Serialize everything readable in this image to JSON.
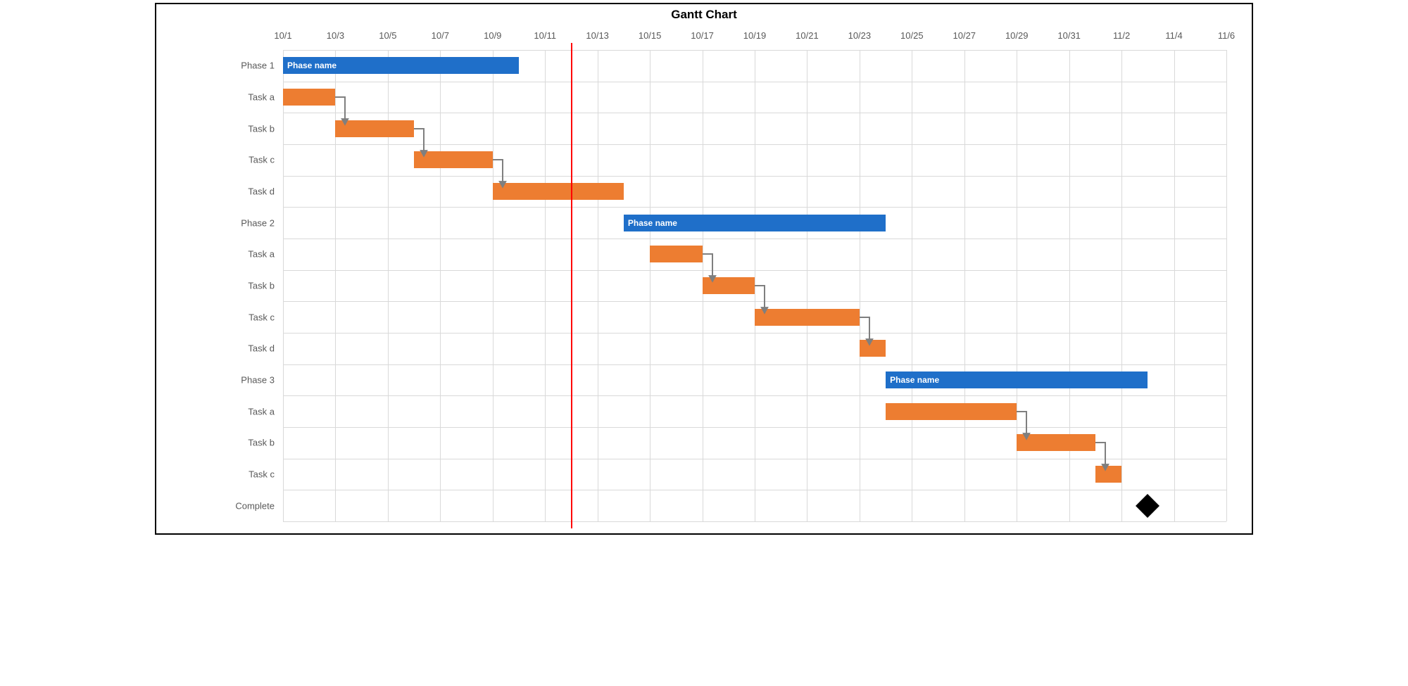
{
  "chart_data": {
    "type": "gantt",
    "title": "Gantt Chart",
    "x_axis": {
      "min": "10/1",
      "max": "11/6",
      "ticks": [
        "10/1",
        "10/3",
        "10/5",
        "10/7",
        "10/9",
        "10/11",
        "10/13",
        "10/15",
        "10/17",
        "10/19",
        "10/21",
        "10/23",
        "10/25",
        "10/27",
        "10/29",
        "10/31",
        "11/2",
        "11/4",
        "11/6"
      ]
    },
    "today": "10/12",
    "rows": [
      {
        "id": "Phase 1",
        "label": "Phase 1",
        "type": "phase",
        "start": "10/1",
        "end": "10/10",
        "text": "Phase name"
      },
      {
        "id": "P1Ta",
        "label": "Task a",
        "type": "task",
        "start": "10/1",
        "end": "10/3",
        "dep_to": "P1Tb"
      },
      {
        "id": "P1Tb",
        "label": "Task b",
        "type": "task",
        "start": "10/3",
        "end": "10/6",
        "dep_to": "P1Tc"
      },
      {
        "id": "P1Tc",
        "label": "Task c",
        "type": "task",
        "start": "10/6",
        "end": "10/9",
        "dep_to": "P1Td"
      },
      {
        "id": "P1Td",
        "label": "Task d",
        "type": "task",
        "start": "10/9",
        "end": "10/14"
      },
      {
        "id": "Phase 2",
        "label": "Phase 2",
        "type": "phase",
        "start": "10/14",
        "end": "10/24",
        "text": "Phase name"
      },
      {
        "id": "P2Ta",
        "label": "Task a",
        "type": "task",
        "start": "10/15",
        "end": "10/17",
        "dep_to": "P2Tb"
      },
      {
        "id": "P2Tb",
        "label": "Task b",
        "type": "task",
        "start": "10/17",
        "end": "10/19",
        "dep_to": "P2Tc"
      },
      {
        "id": "P2Tc",
        "label": "Task c",
        "type": "task",
        "start": "10/19",
        "end": "10/23",
        "dep_to": "P2Td"
      },
      {
        "id": "P2Td",
        "label": "Task d",
        "type": "task",
        "start": "10/23",
        "end": "10/24"
      },
      {
        "id": "Phase 3",
        "label": "Phase 3",
        "type": "phase",
        "start": "10/24",
        "end": "11/3",
        "text": "Phase name"
      },
      {
        "id": "P3Ta",
        "label": "Task a",
        "type": "task",
        "start": "10/24",
        "end": "10/29",
        "dep_to": "P3Tb"
      },
      {
        "id": "P3Tb",
        "label": "Task b",
        "type": "task",
        "start": "10/29",
        "end": "11/1",
        "dep_to": "P3Tc"
      },
      {
        "id": "P3Tc",
        "label": "Task c",
        "type": "task",
        "start": "11/1",
        "end": "11/2"
      },
      {
        "id": "Complete",
        "label": "Complete",
        "type": "milestone",
        "date": "11/3"
      }
    ],
    "colors": {
      "phase": "#1f6fc9",
      "task": "#ed7d31",
      "today": "#ff0000",
      "milestone": "#000000"
    }
  }
}
